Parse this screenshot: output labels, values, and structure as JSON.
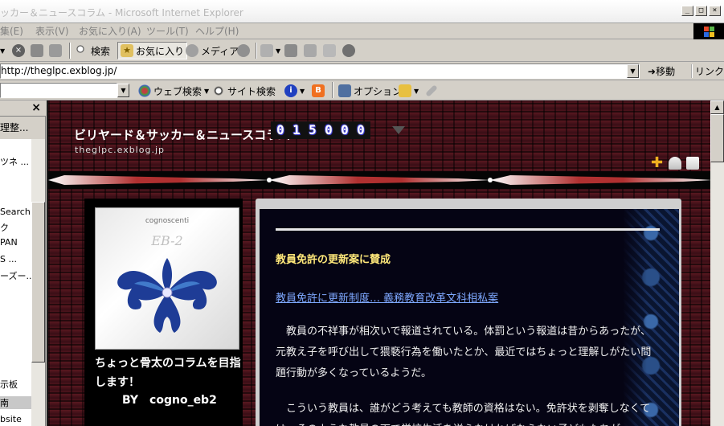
{
  "window": {
    "title": "ッカー＆ニュースコラム - Microsoft Internet Explorer",
    "minimize": "_",
    "maximize": "□",
    "close": "×"
  },
  "menu": {
    "items": [
      "集(E)",
      "表示(V)",
      "お気に入り(A)",
      "ツール(T)",
      "ヘルプ(H)"
    ]
  },
  "toolbar": {
    "search": "検索",
    "favorites": "お気に入り",
    "media": "メディア"
  },
  "address": {
    "url": "http://theglpc.exblog.jp/",
    "go": "移動",
    "links": "リンク"
  },
  "searchbar": {
    "web_search": "ウェブ検索",
    "site_search": "サイト検索",
    "options": "オプション"
  },
  "sidebar": {
    "close": "×",
    "organize": "理整...",
    "items": [
      "ツネ ...",
      "Search",
      "ク",
      "PAN",
      "S ...",
      "ーズー...",
      "示板",
      "南",
      "bsite"
    ]
  },
  "blog": {
    "title": "ビリヤード＆サッカー＆ニュースコラム",
    "url": "theglpc.exblog.jp",
    "counter": [
      "0",
      "1",
      "5",
      "0",
      "0",
      "0"
    ],
    "logo_caption": "cognoscenti",
    "logo_mark": "EB-2",
    "profile_text": "ちょっと骨太のコラムを目指します！",
    "profile_by": "BY　cogno_eb2"
  },
  "post": {
    "title": "教員免許の更新案に賛成",
    "link": "教員免許に更新制度… 義務教育改革文科相私案",
    "para1": "　教員の不祥事が相次いで報道されている。体罰という報道は昔からあったが、元教え子を呼び出して猥褻行為を働いたとか、最近ではちょっと理解しがたい問題行動が多くなっているようだ。",
    "para2": "　こういう教員は、誰がどう考えても教師の資格はない。免許状を剥奪しなくては、そのような教員の下で学校生活を送らなければならない子どもたちが"
  },
  "colors": {
    "post_title": "#ffe87a",
    "post_link": "#7ea8ff",
    "page_bg": "#2a0c12"
  },
  "icons": [
    "back-icon",
    "stop-icon",
    "refresh-icon",
    "home-icon",
    "search-icon",
    "favorites-icon",
    "media-icon",
    "history-icon",
    "mail-icon",
    "print-icon",
    "edit-icon",
    "discuss-icon",
    "messenger-icon",
    "go-arrow-icon",
    "add-icon",
    "profile-icon",
    "rss-icon"
  ]
}
